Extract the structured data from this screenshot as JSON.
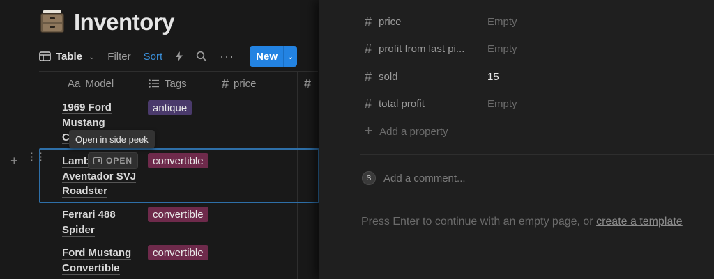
{
  "page": {
    "title": "Inventory",
    "icon": "file-cabinet-icon"
  },
  "toolbar": {
    "view_label": "Table",
    "filter_label": "Filter",
    "sort_label": "Sort",
    "new_label": "New"
  },
  "columns": {
    "model": "Model",
    "model_prefix": "Aa",
    "tags": "Tags",
    "price": "price"
  },
  "rows": [
    {
      "model": "1969 Ford Mustang C",
      "model_lines": [
        "1969 Ford",
        "Mustang",
        "C"
      ],
      "tag": "antique"
    },
    {
      "model": "Lamb Aventador SVJ Roadster",
      "model_lines": [
        "Lamb",
        "Aventador SVJ",
        "Roadster"
      ],
      "tag": "convertible"
    },
    {
      "model": "Ferrari 488 Spider",
      "model_lines": [
        "Ferrari 488",
        "Spider"
      ],
      "tag": "convertible"
    },
    {
      "model": "Ford Mustang Convertible",
      "model_lines": [
        "Ford Mustang",
        "Convertible"
      ],
      "tag": "convertible"
    }
  ],
  "row_actions": {
    "open_label": "OPEN",
    "tooltip": "Open in side peek"
  },
  "peek": {
    "properties": [
      {
        "name": "price",
        "value": "Empty"
      },
      {
        "name": "profit from last pi...",
        "value": "Empty"
      },
      {
        "name": "sold",
        "value": "15"
      },
      {
        "name": "total profit",
        "value": "Empty"
      }
    ],
    "add_property": "Add a property",
    "comment_avatar": "S",
    "comment_placeholder": "Add a comment...",
    "empty_hint": "Press Enter to continue with an empty page, or",
    "template_link": "create a template"
  },
  "colors": {
    "accent": "#2383e2",
    "tag_antique": "#4a3a6b",
    "tag_convertible": "#6e2a4b"
  }
}
